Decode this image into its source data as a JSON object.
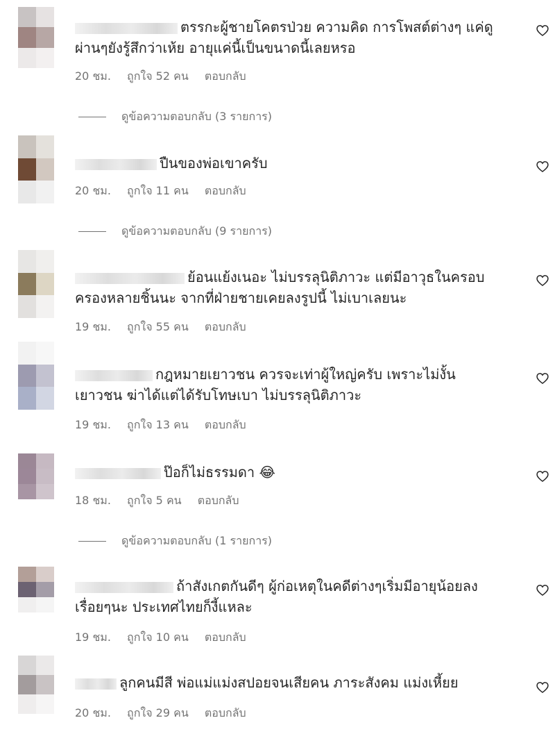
{
  "comments": [
    {
      "lines": [
        "ตรรกะผู้ชายโคตรป่วย ความคิด การโพสต์ต่างๆ แค่ดู",
        "ผ่านๆยังรู้สึกว่าเห้ย อายุแค่นี้เป็นขนาดนี้เลยหรอ"
      ],
      "time": "20 ชม.",
      "likes": "ถูกใจ 52 คน",
      "reply": "ตอบกลับ",
      "avatar_colors": [
        "#c8c3c3",
        "#e6e2e2",
        "#9f8582",
        "#b7a7a5",
        "#ece9e9",
        "#f3f0f0"
      ]
    },
    {
      "lines": [
        "ปืนของพ่อเขาครับ"
      ],
      "time": "20 ชม.",
      "likes": "ถูกใจ 11 คน",
      "reply": "ตอบกลับ",
      "avatar_colors": [
        "#c9c3bd",
        "#e4e1dc",
        "#6f4a35",
        "#d2c8c0",
        "#e8e8e8",
        "#f1f1f1"
      ]
    },
    {
      "lines": [
        "ย้อนแย้งเนอะ ไม่บรรลุนิติภาวะ แต่มีอาวุธในครอบ",
        "ครองหลายชิ้นนะ จากที่ฝ่ายชายเคยลงรูปนี้ ไม่เบาเลยนะ"
      ],
      "time": "19 ชม.",
      "likes": "ถูกใจ 55 คน",
      "reply": "ตอบกลับ",
      "avatar_colors": [
        "#e7e6e4",
        "#f0efed",
        "#8b7b5c",
        "#ddd6c4",
        "#e2e0de",
        "#f3f2f1"
      ]
    },
    {
      "lines": [
        "กฎหมายเยาวชน ควรจะเท่าผู้ใหญ่ครับ เพราะไม่งั้น",
        "เยาวชน ฆ่าได้แต่ได้รับโทษเบา ไม่บรรลุนิติภาวะ"
      ],
      "time": "19 ชม.",
      "likes": "ถูกใจ 13 คน",
      "reply": "ตอบกลับ",
      "avatar_colors": [
        "#f2f2f2",
        "#f7f7f7",
        "#9d9bb0",
        "#c3c2d0",
        "#a9b0c8",
        "#d2d6e3"
      ]
    },
    {
      "lines": [
        "ป๊อก็ไม่ธรรมดา 😂"
      ],
      "time": "18 ชม.",
      "likes": "ถูกใจ 5 คน",
      "reply": "ตอบกลับ",
      "avatar_colors": [
        "#9b8796",
        "#c6b9c2",
        "#9c8798",
        "#c8bcc5",
        "#a895a4",
        "#cfc4cc"
      ]
    },
    {
      "lines": [
        "ถ้าสังเกตกันดีๆ ผู้ก่อเหตุในคดีต่างๆเริ่มมีอายุน้อยลง",
        "เรื่อยๆนะ ประเทศไทยก็งี้แหละ"
      ],
      "time": "19 ชม.",
      "likes": "ถูกใจ 10 คน",
      "reply": "ตอบกลับ",
      "avatar_colors": [
        "#b39f98",
        "#d9cdca",
        "#6c6272",
        "#a49da8",
        "#f0efef",
        "#f5f5f5"
      ]
    },
    {
      "lines": [
        "ลูกคนมีสี พ่อแม่แม่งสปอยจนเสียคน ภาระสังคม แม่งเหี้ยย"
      ],
      "time": "20 ชม.",
      "likes": "ถูกใจ 29 คน",
      "reply": "ตอบกลับ",
      "avatar_colors": [
        "#d8d6d6",
        "#ebe9e9",
        "#a39c9d",
        "#c9c3c4",
        "#efeded",
        "#f6f5f5"
      ]
    }
  ],
  "reply_threads": [
    {
      "label": "ดูข้อความตอบกลับ (3 รายการ)"
    },
    {
      "label": "ดูข้อความตอบกลับ (9 รายการ)"
    },
    {
      "label": "ดูข้อความตอบกลับ (1 รายการ)"
    }
  ],
  "icons": {
    "like": "heart-outline-icon"
  }
}
